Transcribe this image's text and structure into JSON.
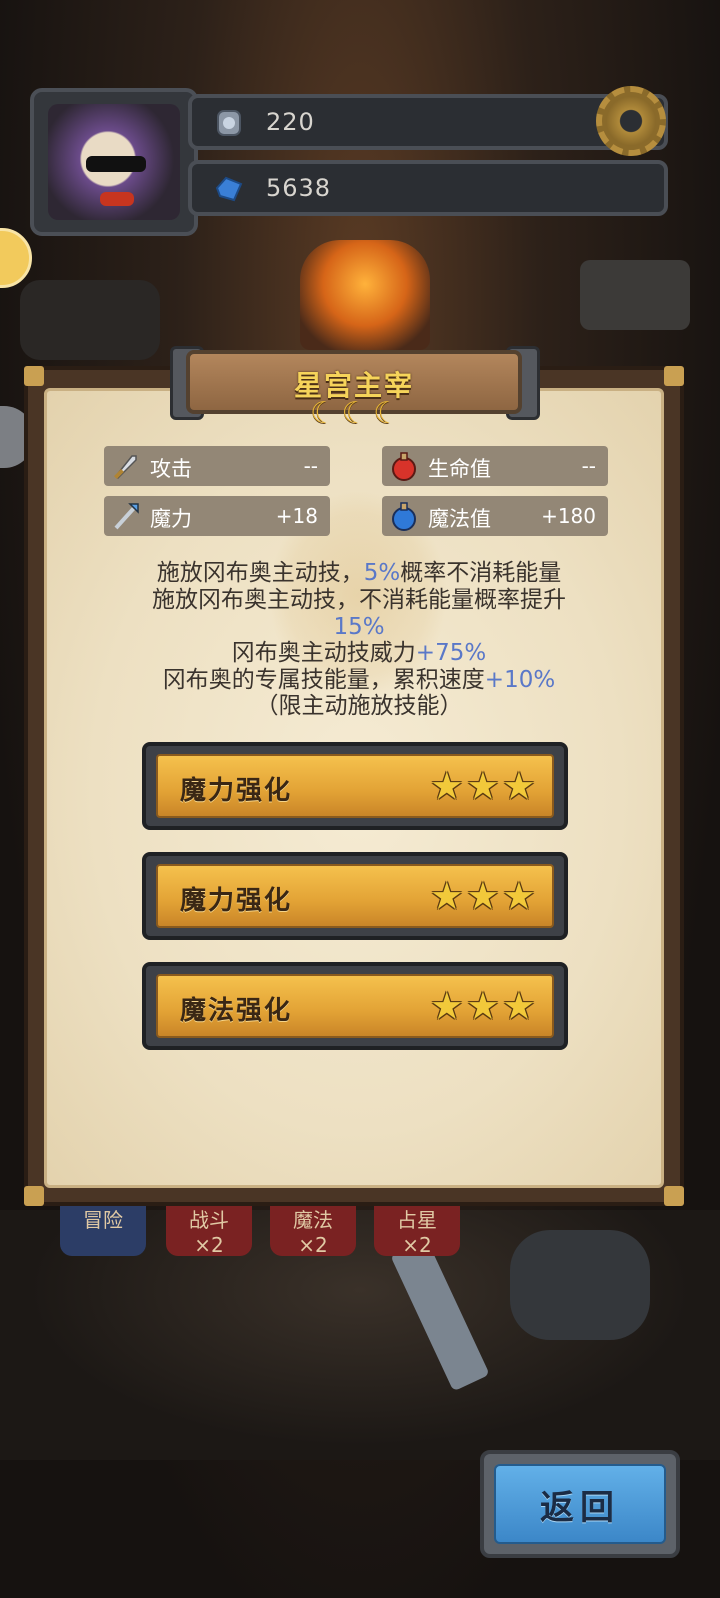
{
  "hud": {
    "gem_count": "220",
    "crystal_count": "5638"
  },
  "bottom_tabs": [
    {
      "label": "冒险",
      "mult": ""
    },
    {
      "label": "战斗",
      "mult": "×2"
    },
    {
      "label": "魔法",
      "mult": "×2"
    },
    {
      "label": "占星",
      "mult": "×2"
    }
  ],
  "dialog": {
    "title": "星宫主宰",
    "moons": [
      "☾",
      "☾",
      "☾"
    ],
    "stats": [
      {
        "icon": "sword-icon",
        "glyph": "🗡",
        "label": "攻击",
        "value": "--"
      },
      {
        "icon": "red-potion-icon",
        "glyph": "⚗",
        "label": "生命值",
        "value": "--"
      },
      {
        "icon": "magic-staff-icon",
        "glyph": "✦",
        "label": "魔力",
        "value": "+18"
      },
      {
        "icon": "blue-potion-icon",
        "glyph": "⚗",
        "label": "魔法值",
        "value": "+180"
      }
    ],
    "desc": {
      "line1_pre": "施放冈布奥主动技，",
      "line1_hl": "5%",
      "line1_post": "概率不消耗能量",
      "line2": "施放冈布奥主动技，不消耗能量概率提升",
      "line2_hl": "15%",
      "line3_pre": "冈布奥主动技威力",
      "line3_hl": "+75%",
      "line4_pre": "冈布奥的专属技能量，累积速度",
      "line4_hl": "+10%",
      "line5": "（限主动施放技能）"
    },
    "upgrades": [
      {
        "label": "魔力强化",
        "stars": 3
      },
      {
        "label": "魔力强化",
        "stars": 3
      },
      {
        "label": "魔法强化",
        "stars": 3
      }
    ]
  },
  "back_button": {
    "label": "返回"
  },
  "colors": {
    "highlight": "#5a78c8",
    "title_gold": "#f6d45a",
    "button_orange": "#e2a235",
    "back_blue": "#3c87c8"
  }
}
